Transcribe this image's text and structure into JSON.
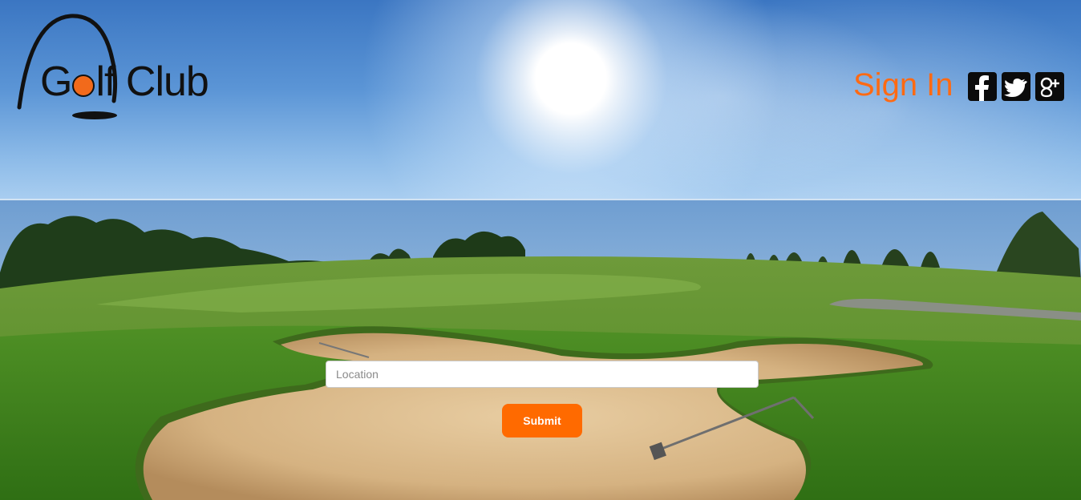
{
  "header": {
    "logo": {
      "text_before": "G",
      "text_after": "lf Club"
    },
    "sign_in_label": "Sign In",
    "social": [
      {
        "name": "facebook-icon",
        "glyph": "f"
      },
      {
        "name": "twitter-icon",
        "glyph": "🐦"
      },
      {
        "name": "google-plus-icon",
        "glyph": "g+"
      }
    ]
  },
  "search": {
    "placeholder": "Location",
    "value": ""
  },
  "actions": {
    "submit_label": "Submit"
  },
  "colors": {
    "accent": "#ff6a00",
    "sign_in": "#ff6a13",
    "social_bg": "#0b0b0b"
  }
}
